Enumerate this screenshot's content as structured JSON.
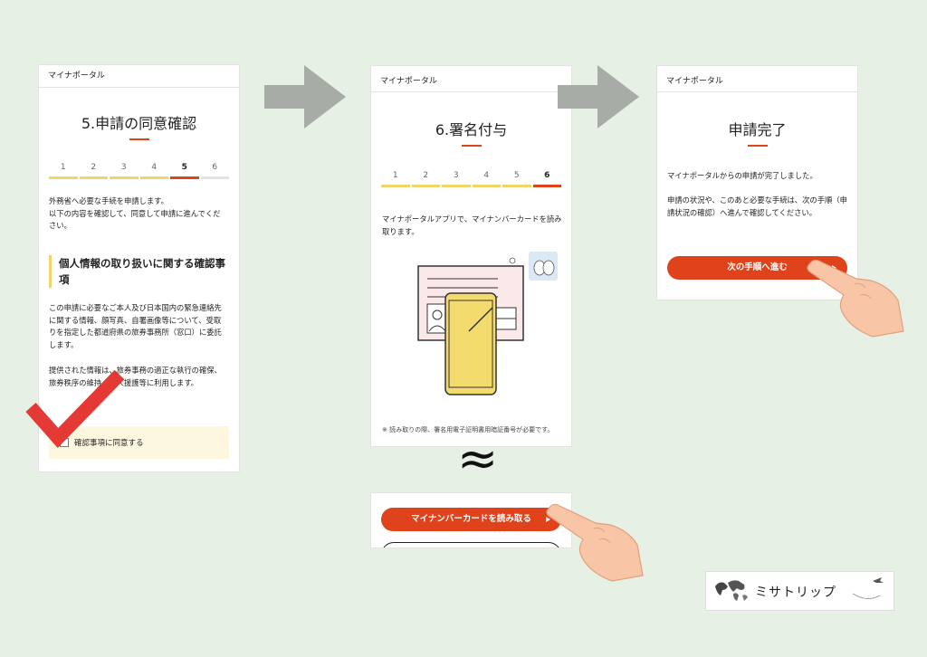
{
  "portal_name": "マイナポータル",
  "panel1": {
    "title": "5.申請の同意確認",
    "steps": [
      "1",
      "2",
      "3",
      "4",
      "5",
      "6"
    ],
    "intro": "外務省へ必要な手続を申請します。\n以下の内容を確認して、同意して申請に進んでください。",
    "section_heading": "個人情報の取り扱いに関する確認事項",
    "paragraph1": "この申請に必要なご本人及び日本国内の緊急連絡先に関する情報、顔写真、自署画像等について、受取りを指定した都道府県の旅券事務所（窓口）に委託します。",
    "paragraph2": "提供された情報は、旅券事務の適正な執行の確保、旅券秩序の維持、邦人援護等に利用します。",
    "agree_label": "確認事項に同意する"
  },
  "panel2": {
    "title": "6.署名付与",
    "steps": [
      "1",
      "2",
      "3",
      "4",
      "5",
      "6"
    ],
    "intro": "マイナポータルアプリで、マイナンバーカードを読み取ります。",
    "note": "※ 読み取りの際、署名用電子証明書用暗証番号が必要です。"
  },
  "panel3": {
    "title": "申請完了",
    "text1": "マイナポータルからの申請が完了しました。",
    "text2": "申請の状況や、このあと必要な手続は、次の手順（申請状況の確認）へ進んで確認してください。",
    "next_button": "次の手順へ進む"
  },
  "panel4": {
    "read_button": "マイナンバーカードを読み取る"
  },
  "ellipsis_symbol": "≈",
  "logo": {
    "text": "ミサトリップ"
  },
  "colors": {
    "accent_red": "#e0421b",
    "step_yellow": "#f1d56a",
    "background": "#e7f0e4",
    "arrow_gray": "#a8aca7",
    "check_red": "#e53935"
  },
  "icons": [
    "arrow-right-icon",
    "checkmark-icon",
    "pointing-hand-icon",
    "mynumber-card-illustration",
    "world-map-icon",
    "airplane-icon"
  ]
}
